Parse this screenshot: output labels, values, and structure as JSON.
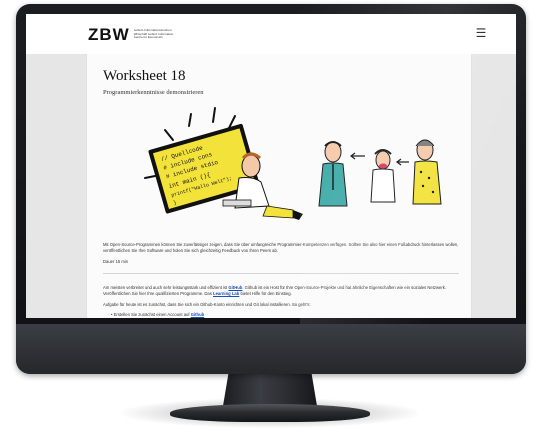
{
  "header": {
    "logo_mark": "ZBW",
    "logo_text": "Leibniz-Informationszentrum Wirtschaft Leibniz Information Centre for Economics",
    "menu_icon": "☰"
  },
  "worksheet": {
    "title": "Worksheet 18",
    "subtitle": "Programmierkenntnisse demonstrieren",
    "code_lines": [
      "// Quellcode",
      "# include cons",
      "# include stdio",
      "int main (){",
      "printf(\"Hallo Welt\");",
      "}"
    ],
    "description": "Mit Open-Source-Programmen können Sie zuverlässiger zeigen, dass Sie über umfangreiche Programmier-Kompetenzen verfügen. Sollten Sie also hier einen Fußabdruck hinterlassen wollen, veröffentlichen Sie Ihre Software und holen Sie sich gleichzeitig Feedback von Ihren Peers ab.",
    "duration": "Dauer 15 min",
    "para1_a": "Am meisten verbreitet und auch sehr leistungsstark und effizient ist ",
    "para1_link": "GitHub",
    "para1_b": ". Github ist ein Host für Ihre Open-Source-Projekte und hat ähnliche Eigenschaften wie ein soziales Netzwerk. Veröffentlichen Sie hier Ihre qualifizierten Programme. Das ",
    "para1_link2": "Learning Lab",
    "para1_c": " bietet Hilfe für den Einstieg.",
    "para2": "Aufgabe für heute ist es zunächst, dass Sie sich ein Github-Konto einrichten und Git lokal installieren. So geht's:",
    "bullet1_a": "Erstellen Sie zunächst einen Account auf ",
    "bullet1_link": "Github"
  },
  "colors": {
    "screen_yellow": "#f2e23a",
    "code_bg": "#1c1c1c",
    "shirt_teal": "#3aa9a6",
    "link": "#1a4fb4"
  }
}
